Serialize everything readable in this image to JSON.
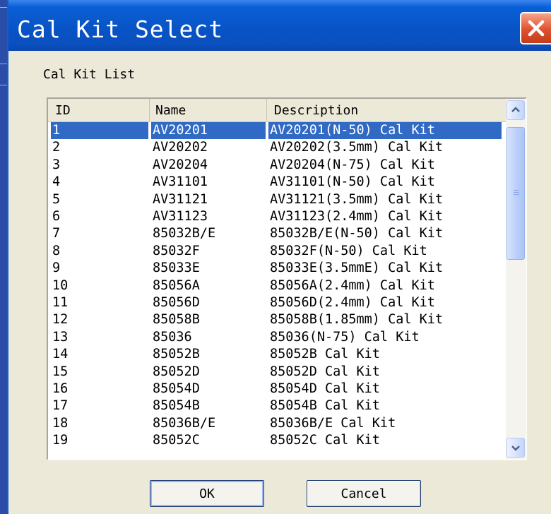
{
  "dialog": {
    "title": "Cal Kit Select",
    "group_label": "Cal Kit List",
    "ok_label": "OK",
    "cancel_label": "Cancel"
  },
  "list": {
    "columns": [
      "ID",
      "Name",
      "Description"
    ],
    "selected_index": 0,
    "rows": [
      {
        "id": "1",
        "name": "AV20201",
        "description": "AV20201(N-50) Cal Kit"
      },
      {
        "id": "2",
        "name": "AV20202",
        "description": "AV20202(3.5mm) Cal Kit"
      },
      {
        "id": "3",
        "name": "AV20204",
        "description": "AV20204(N-75) Cal Kit"
      },
      {
        "id": "4",
        "name": "AV31101",
        "description": "AV31101(N-50) Cal Kit"
      },
      {
        "id": "5",
        "name": "AV31121",
        "description": "AV31121(3.5mm) Cal Kit"
      },
      {
        "id": "6",
        "name": "AV31123",
        "description": "AV31123(2.4mm) Cal Kit"
      },
      {
        "id": "7",
        "name": "85032B/E",
        "description": "85032B/E(N-50) Cal Kit"
      },
      {
        "id": "8",
        "name": "85032F",
        "description": "85032F(N-50) Cal Kit"
      },
      {
        "id": "9",
        "name": "85033E",
        "description": "85033E(3.5mmE) Cal Kit"
      },
      {
        "id": "10",
        "name": "85056A",
        "description": "85056A(2.4mm) Cal Kit"
      },
      {
        "id": "11",
        "name": "85056D",
        "description": "85056D(2.4mm) Cal Kit"
      },
      {
        "id": "12",
        "name": "85058B",
        "description": "85058B(1.85mm) Cal Kit"
      },
      {
        "id": "13",
        "name": "85036",
        "description": "85036(N-75) Cal Kit"
      },
      {
        "id": "14",
        "name": "85052B",
        "description": "85052B Cal Kit"
      },
      {
        "id": "15",
        "name": "85052D",
        "description": "85052D Cal Kit"
      },
      {
        "id": "16",
        "name": "85054D",
        "description": "85054D Cal Kit"
      },
      {
        "id": "17",
        "name": "85054B",
        "description": "85054B Cal Kit"
      },
      {
        "id": "18",
        "name": "85036B/E",
        "description": "85036B/E Cal Kit"
      },
      {
        "id": "19",
        "name": "85052C",
        "description": "85052C Cal Kit"
      }
    ]
  },
  "icons": {
    "close": "close-icon",
    "scroll_up": "chevron-up-icon",
    "scroll_down": "chevron-down-icon"
  },
  "colors": {
    "title_bar": "#0a5fd6",
    "selection": "#316ac5",
    "close_button": "#e0512e",
    "dialog_face": "#ece9d8"
  }
}
